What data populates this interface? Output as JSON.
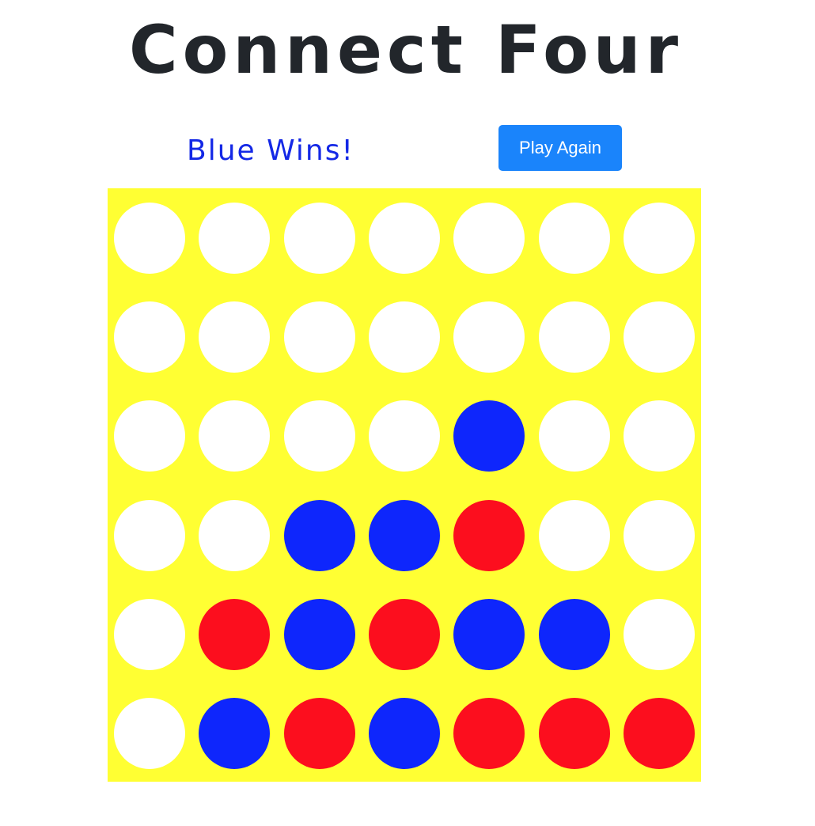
{
  "title": "Connect Four",
  "status": {
    "text": "Blue Wins!",
    "color": "#1428e6"
  },
  "controls": {
    "play_again_label": "Play Again"
  },
  "colors": {
    "title": "#22262b",
    "button_bg": "#1a84fb",
    "button_text": "#ffffff",
    "board": "#ffff33",
    "empty": "#ffffff",
    "blue": "#0e26fc",
    "red": "#fc0e1e"
  },
  "board": {
    "rows": 6,
    "columns": 7,
    "cells": [
      [
        "empty",
        "empty",
        "empty",
        "empty",
        "empty",
        "empty",
        "empty"
      ],
      [
        "empty",
        "empty",
        "empty",
        "empty",
        "empty",
        "empty",
        "empty"
      ],
      [
        "empty",
        "empty",
        "empty",
        "empty",
        "blue",
        "empty",
        "empty"
      ],
      [
        "empty",
        "empty",
        "blue",
        "blue",
        "red",
        "empty",
        "empty"
      ],
      [
        "empty",
        "red",
        "blue",
        "red",
        "blue",
        "blue",
        "empty"
      ],
      [
        "empty",
        "blue",
        "red",
        "blue",
        "red",
        "red",
        "red"
      ]
    ]
  }
}
